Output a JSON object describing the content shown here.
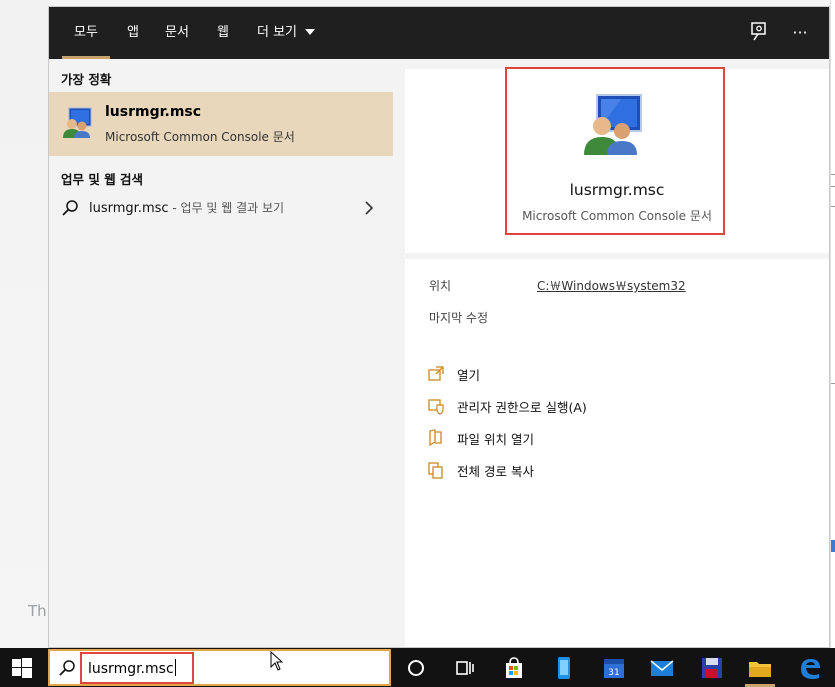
{
  "background": {
    "bottom_text": "Th"
  },
  "tabs": [
    {
      "label": "모두",
      "active": true
    },
    {
      "label": "앱"
    },
    {
      "label": "문서"
    },
    {
      "label": "웹"
    },
    {
      "label": "더 보기"
    }
  ],
  "left": {
    "best_match_heading": "가장 정확",
    "best_match": {
      "title": "lusrmgr.msc",
      "subtitle": "Microsoft Common Console 문서"
    },
    "web_heading": "업무 및 웹 검색",
    "web_result": {
      "query": "lusrmgr.msc",
      "suffix": " - 업무 및 웹 결과 보기"
    }
  },
  "preview": {
    "title": "lusrmgr.msc",
    "subtitle": "Microsoft Common Console 문서",
    "location_label": "위치",
    "location_value": "C:￦Windows￦system32",
    "modified_label": "마지막 수정"
  },
  "actions": {
    "open": "열기",
    "run_as_admin": "관리자 권한으로 실행(A)",
    "open_file_location": "파일 위치 열기",
    "copy_full_path": "전체 경로 복사"
  },
  "search": {
    "value": "lusrmgr.msc"
  },
  "colors": {
    "accent": "#c9a36b",
    "highlight_red": "#e0443f",
    "best_match_bg": "#e8d7bb",
    "topbar": "#1f1f1f"
  }
}
